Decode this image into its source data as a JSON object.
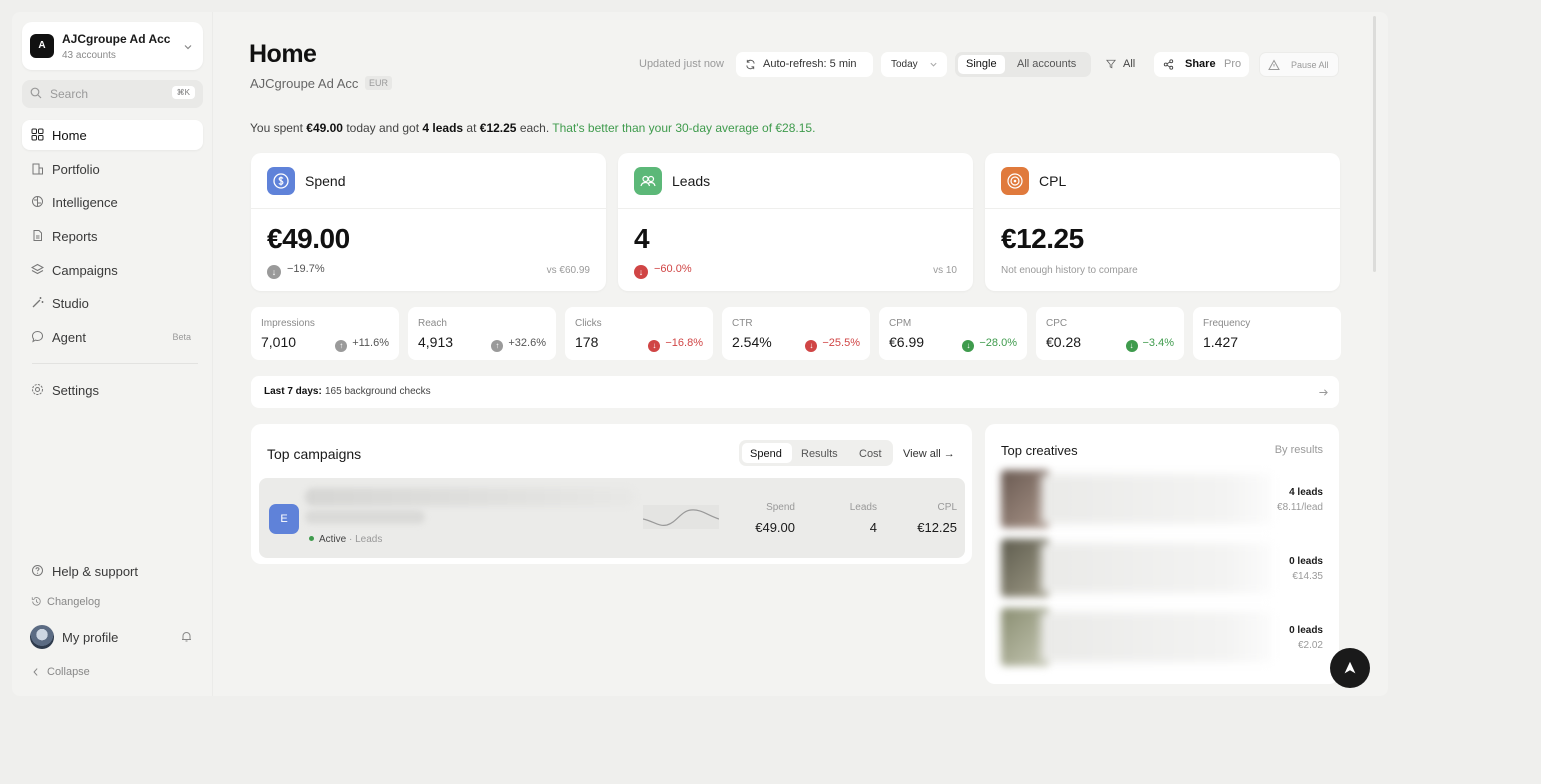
{
  "sidebar": {
    "account": {
      "avatar": "A",
      "name": "AJCgroupe Ad Acc",
      "count": "43 accounts"
    },
    "search": {
      "placeholder": "Search",
      "shortcut": "⌘K"
    },
    "nav": [
      {
        "label": "Home",
        "icon": "grid-icon"
      },
      {
        "label": "Portfolio",
        "icon": "building-icon"
      },
      {
        "label": "Intelligence",
        "icon": "brain-icon"
      },
      {
        "label": "Reports",
        "icon": "document-icon"
      },
      {
        "label": "Campaigns",
        "icon": "layers-icon"
      },
      {
        "label": "Studio",
        "icon": "wand-icon"
      },
      {
        "label": "Agent",
        "icon": "chat-icon",
        "badge": "Beta"
      }
    ],
    "settings": "Settings",
    "help": "Help & support",
    "changelog": "Changelog",
    "profile": "My profile",
    "collapse": "Collapse"
  },
  "header": {
    "title": "Home",
    "account": "AJCgroupe Ad Acc",
    "currency": "EUR",
    "updated": "Updated just now",
    "auto_refresh": "Auto-refresh: 5 min",
    "range": "Today",
    "scope_single": "Single",
    "scope_all": "All accounts",
    "filter": "All",
    "share": "Share",
    "share_badge": "Pro",
    "pause": "Pause All"
  },
  "summary": {
    "p1": "You spent ",
    "spend": "€49.00",
    "p2": " today and got ",
    "leads": "4 leads",
    "p3": " at ",
    "cpl": "€12.25",
    "p4": " each. ",
    "good": "That's better than your 30-day average of €28.15."
  },
  "kpis": {
    "spend": {
      "title": "Spend",
      "value": "€49.00",
      "delta": "−19.7%",
      "vs": "vs €60.99"
    },
    "leads": {
      "title": "Leads",
      "value": "4",
      "delta": "−60.0%",
      "vs": "vs 10"
    },
    "cpl": {
      "title": "CPL",
      "value": "€12.25",
      "note": "Not enough history to compare"
    }
  },
  "metrics": [
    {
      "label": "Impressions",
      "value": "7,010",
      "delta": "+11.6%"
    },
    {
      "label": "Reach",
      "value": "4,913",
      "delta": "+32.6%"
    },
    {
      "label": "Clicks",
      "value": "178",
      "delta": "−16.8%"
    },
    {
      "label": "CTR",
      "value": "2.54%",
      "delta": "−25.5%"
    },
    {
      "label": "CPM",
      "value": "€6.99",
      "delta": "−28.0%"
    },
    {
      "label": "CPC",
      "value": "€0.28",
      "delta": "−3.4%"
    },
    {
      "label": "Frequency",
      "value": "1.427",
      "delta": ""
    }
  ],
  "checks": {
    "prefix": "Last 7 days:",
    "text": " 165 background checks"
  },
  "top_campaigns": {
    "title": "Top campaigns",
    "tabs": [
      "Spend",
      "Results",
      "Cost"
    ],
    "view_all": "View all →",
    "row": {
      "avatar": "E",
      "status": "Active",
      "objective": "· Leads",
      "spend_label": "Spend",
      "spend": "€49.00",
      "leads_label": "Leads",
      "leads": "4",
      "cpl_label": "CPL",
      "cpl": "€12.25"
    }
  },
  "top_creatives": {
    "title": "Top creatives",
    "sort": "By results",
    "items": [
      {
        "leads": "4 leads",
        "cpl": "€8.11/lead"
      },
      {
        "leads": "0 leads",
        "cpl": "€14.35"
      },
      {
        "leads": "0 leads",
        "cpl": "€2.02"
      }
    ]
  },
  "colors": {
    "positive": "#3f9b4d",
    "negative": "#d04545",
    "neutral": "#9a9a9a",
    "spend_icon": "#5f82d9",
    "leads_icon": "#5cb878",
    "cpl_icon": "#e07a3c"
  }
}
